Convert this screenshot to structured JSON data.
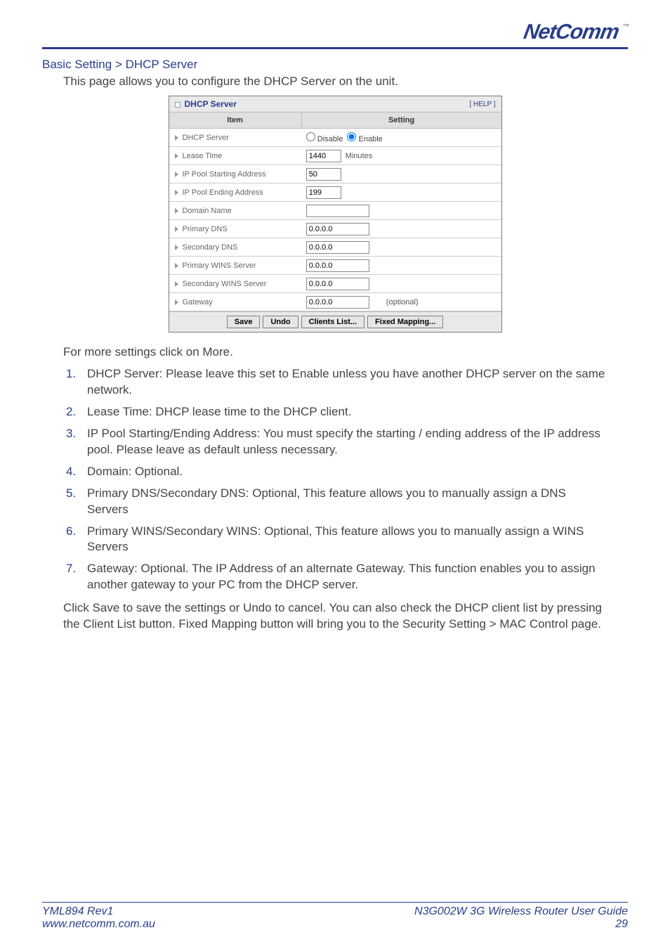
{
  "brand": {
    "name": "NetComm",
    "tm": "™"
  },
  "breadcrumb": "Basic Setting > DHCP Server",
  "intro": "This page allows you to configure the DHCP Server on the unit.",
  "panel": {
    "title": "DHCP Server",
    "help": "[ HELP ]",
    "headers": {
      "item": "Item",
      "setting": "Setting"
    },
    "rows": {
      "dhcp_server": {
        "label": "DHCP Server",
        "disable": "Disable",
        "enable": "Enable",
        "value": "enable"
      },
      "lease_time": {
        "label": "Lease Time",
        "value": "1440",
        "unit": "Minutes"
      },
      "pool_start": {
        "label": "IP Pool Starting Address",
        "value": "50"
      },
      "pool_end": {
        "label": "IP Pool Ending Address",
        "value": "199"
      },
      "domain": {
        "label": "Domain Name",
        "value": ""
      },
      "primary_dns": {
        "label": "Primary DNS",
        "value": "0.0.0.0"
      },
      "secondary_dns": {
        "label": "Secondary DNS",
        "value": "0.0.0.0"
      },
      "primary_wins": {
        "label": "Primary WINS Server",
        "value": "0.0.0.0"
      },
      "secondary_wins": {
        "label": "Secondary WINS Server",
        "value": "0.0.0.0"
      },
      "gateway": {
        "label": "Gateway",
        "value": "0.0.0.0",
        "note": "(optional)"
      }
    },
    "buttons": {
      "save": "Save",
      "undo": "Undo",
      "clients": "Clients List...",
      "fixed": "Fixed Mapping..."
    }
  },
  "after_intro": "For more settings click on More.",
  "list": [
    "DHCP Server: Please leave this set to Enable unless you have another DHCP server on the same network.",
    "Lease Time: DHCP lease time to the DHCP client.",
    "IP Pool Starting/Ending Address: You must specify the starting / ending address of the IP address pool. Please leave as default unless necessary.",
    "Domain: Optional.",
    "Primary DNS/Secondary DNS: Optional, This feature allows you to manually assign a DNS Servers",
    "Primary WINS/Secondary WINS: Optional, This feature allows you to manually assign a WINS Servers",
    "Gateway: Optional. The IP Address of an alternate Gateway. This function enables you to assign another gateway to your PC from the DHCP server."
  ],
  "closing": "Click Save to save the settings or Undo to cancel. You can also check the DHCP client list by pressing the Client List button. Fixed Mapping button will bring you to the Security Setting > MAC Control page.",
  "footer": {
    "rev": "YML894 Rev1",
    "site": "www.netcomm.com.au",
    "guide": "N3G002W 3G Wireless Router User Guide",
    "page": "29"
  }
}
